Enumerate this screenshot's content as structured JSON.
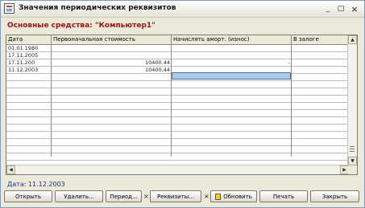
{
  "window": {
    "title": "Значения периодических реквизитов",
    "controls": {
      "minimize": "_",
      "maximize": "□",
      "close": "×"
    }
  },
  "subtitle": "Основные средства: \"Компьютер1\"",
  "table": {
    "columns": [
      "Дата",
      "Первоначальная стоимость",
      "Начислять аморт. (износ)",
      "В залоге"
    ],
    "rows": [
      [
        "01.01.1980",
        "",
        "",
        ""
      ],
      [
        "17.11.2005",
        "",
        "",
        ""
      ],
      [
        "17.11.200",
        "10400.44",
        "-",
        ""
      ],
      [
        "11.12.2003",
        "10400.44",
        "",
        ""
      ],
      [
        "",
        "",
        "",
        ""
      ],
      [
        "",
        "",
        "",
        ""
      ],
      [
        "",
        "",
        "",
        ""
      ],
      [
        "",
        "",
        "",
        ""
      ],
      [
        "",
        "",
        "",
        ""
      ],
      [
        "",
        "",
        "",
        ""
      ],
      [
        "",
        "",
        "",
        ""
      ],
      [
        "",
        "",
        "",
        ""
      ],
      [
        "",
        "",
        "",
        ""
      ],
      [
        "",
        "",
        "",
        ""
      ],
      [
        "",
        "",
        "",
        ""
      ],
      [
        "",
        "",
        "",
        ""
      ]
    ]
  },
  "status": {
    "date_label": "Дата: 11.12.2003"
  },
  "buttons": {
    "open": "Открыть",
    "delete": "Удалить...",
    "period": "Период...",
    "requisites": "Реквизиты...",
    "refresh": "Обновить",
    "print": "Печать",
    "close": "Закрыть"
  }
}
